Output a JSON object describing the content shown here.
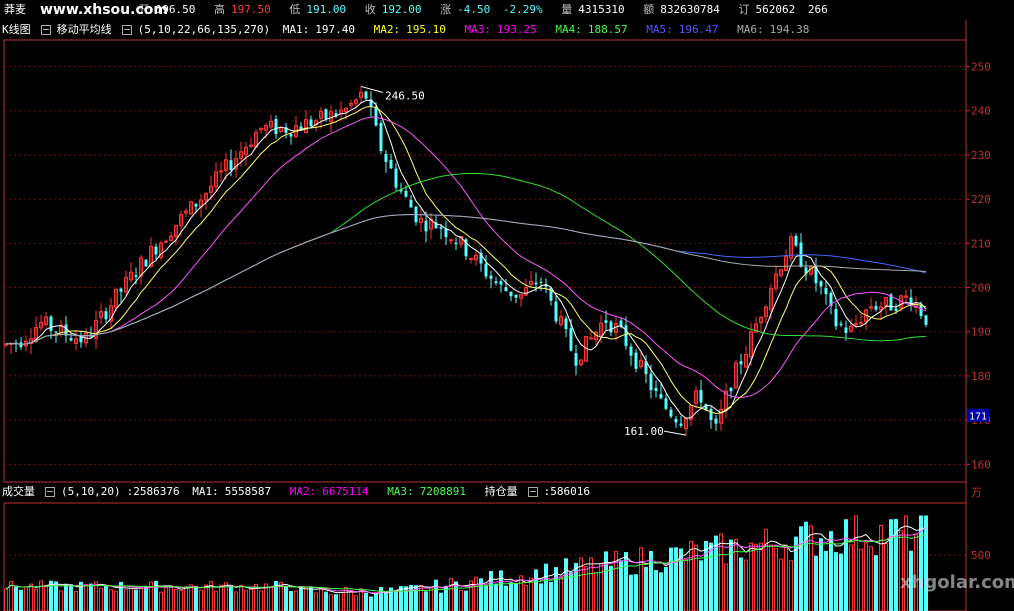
{
  "header": {
    "code": "莽麦",
    "open_label": "开",
    "open": "196.50",
    "high_label": "高",
    "high": "197.50",
    "low_label": "低",
    "low": "191.00",
    "close_label": "收",
    "close": "192.00",
    "change_label": "涨",
    "change": "-4.50",
    "change_pct": "-2.29%",
    "vol_label": "量",
    "vol": "4315310",
    "amt_label": "额",
    "amt": "832630784",
    "oi_label": "订",
    "oi": "562062",
    "extra": "266"
  },
  "kline_bar": {
    "chart_label": "K线图",
    "indicator": "移动平均线",
    "params": "(5,10,22,66,135,270)",
    "ma1_label": "MA1:",
    "ma1": "197.40",
    "ma2_label": "MA2:",
    "ma2": "195.10",
    "ma3_label": "MA3:",
    "ma3": "193.25",
    "ma4_label": "MA4:",
    "ma4": "188.57",
    "ma5_label": "MA5:",
    "ma5": "196.47",
    "ma6_label": "MA6:",
    "ma6": "194.38"
  },
  "volume_bar": {
    "label": "成交量",
    "params": "(5,10,20)",
    "value": ":2586376",
    "ma1_label": "MA1:",
    "ma1": "5558587",
    "ma2_label": "MA2:",
    "ma2": "6675114",
    "ma3_label": "MA3:",
    "ma3": "7208891",
    "oi_label": "持仓量",
    "oi": ":586016"
  },
  "watermark_top": "www.xhsou.com",
  "watermark_bottom": "xhgolar.com",
  "colors": {
    "up": "#ff3333",
    "down": "#55ffff",
    "axis": "#c03030",
    "grid": "#7a1010",
    "ma1": "#ffffff",
    "ma2": "#ffff66",
    "ma3": "#ff55ff",
    "ma4": "#33dd33",
    "ma5": "#4466ff",
    "ma6": "#aaaaaa"
  },
  "chart_data": {
    "type": "candlestick",
    "price_axis": {
      "ticks": [
        "160",
        "170",
        "180",
        "190",
        "200",
        "210",
        "220",
        "230",
        "240",
        "250"
      ],
      "ylim": [
        156,
        256
      ]
    },
    "highlight_price": "171",
    "high_annotation": "246.50",
    "low_annotation": "161.00",
    "volume_axis": {
      "ticks": [
        "500"
      ],
      "unit": "万"
    }
  }
}
